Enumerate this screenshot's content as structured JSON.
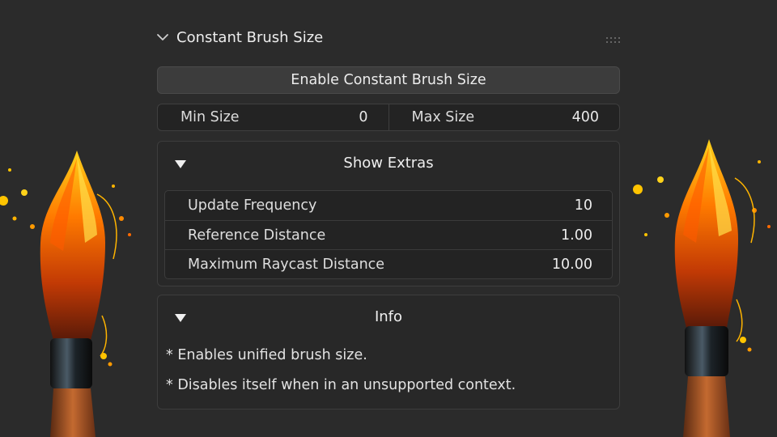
{
  "panel": {
    "title": "Constant Brush Size",
    "enable_button": "Enable Constant Brush Size",
    "min_size": {
      "label": "Min Size",
      "value": "0"
    },
    "max_size": {
      "label": "Max Size",
      "value": "400"
    }
  },
  "extras": {
    "title": "Show Extras",
    "rows": [
      {
        "label": "Update Frequency",
        "value": "10"
      },
      {
        "label": "Reference Distance",
        "value": "1.00"
      },
      {
        "label": "Maximum Raycast Distance",
        "value": "10.00"
      }
    ]
  },
  "info": {
    "title": "Info",
    "lines": [
      "* Enables unified brush size.",
      "* Disables itself when in an unsupported context."
    ]
  },
  "colors": {
    "background": "#2b2b2b",
    "button": "#3c3c3c",
    "field": "#232323",
    "accent_flame": "#ff8a00"
  },
  "icons": [
    "chevron-down-icon",
    "drag-grip-icon",
    "triangle-down-icon",
    "paintbrush-illustration"
  ]
}
